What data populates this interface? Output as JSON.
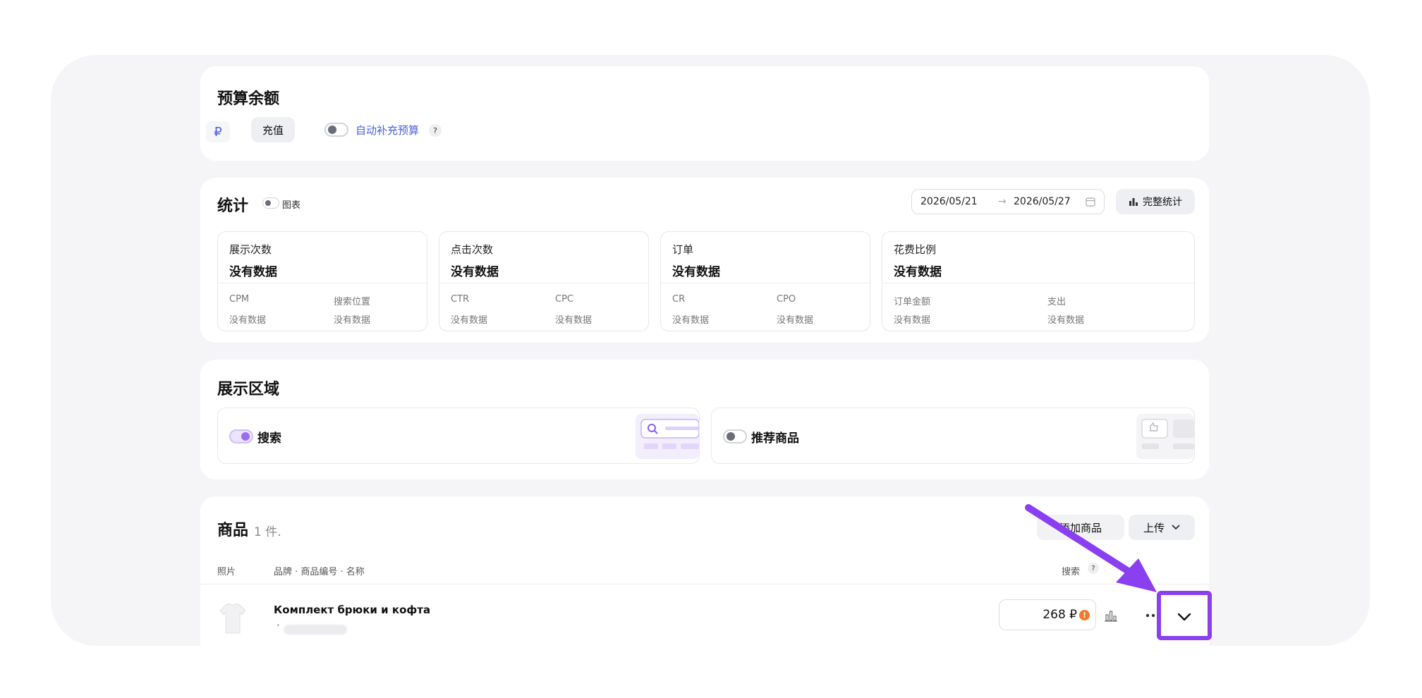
{
  "budget": {
    "title": "预算余额",
    "currency_symbol": "₽",
    "topup_label": "充值",
    "auto_label": "自动补充预算",
    "help_mark": "?"
  },
  "stats": {
    "title": "统计",
    "chart_label": "图表",
    "date_from": "2026/05/21",
    "date_arrow": "→",
    "date_to": "2026/05/27",
    "full_stats_label": "完整统计",
    "boxes": [
      {
        "label": "展示次数",
        "value": "没有数据",
        "sub": [
          {
            "name": "CPM",
            "value": "没有数据"
          },
          {
            "name": "搜索位置",
            "value": "没有数据"
          }
        ]
      },
      {
        "label": "点击次数",
        "value": "没有数据",
        "sub": [
          {
            "name": "CTR",
            "value": "没有数据"
          },
          {
            "name": "CPC",
            "value": "没有数据"
          }
        ]
      },
      {
        "label": "订单",
        "value": "没有数据",
        "sub": [
          {
            "name": "CR",
            "value": "没有数据"
          },
          {
            "name": "CPO",
            "value": "没有数据"
          }
        ]
      },
      {
        "label": "花费比例",
        "value": "没有数据",
        "sub": [
          {
            "name": "订单金额",
            "value": "没有数据"
          },
          {
            "name": "支出",
            "value": "没有数据"
          }
        ]
      }
    ]
  },
  "placement": {
    "title": "展示区域",
    "search_label": "搜索",
    "search_on": true,
    "recommend_label": "推荐商品",
    "recommend_on": false
  },
  "products": {
    "title": "商品",
    "count": "1 件.",
    "add_label": "添加商品",
    "upload_label": "上传",
    "columns": {
      "photo": "照片",
      "name": "品牌 · 商品编号 · 名称",
      "search": "搜索",
      "help": "?"
    },
    "rows": [
      {
        "name": "Комплект брюки и кофта",
        "bullet": "·",
        "price": "268 ₽",
        "warning": "!"
      }
    ]
  },
  "colors": {
    "accent": "#8a3ff0",
    "link": "#4a62d8",
    "warning": "#f07a2a"
  }
}
